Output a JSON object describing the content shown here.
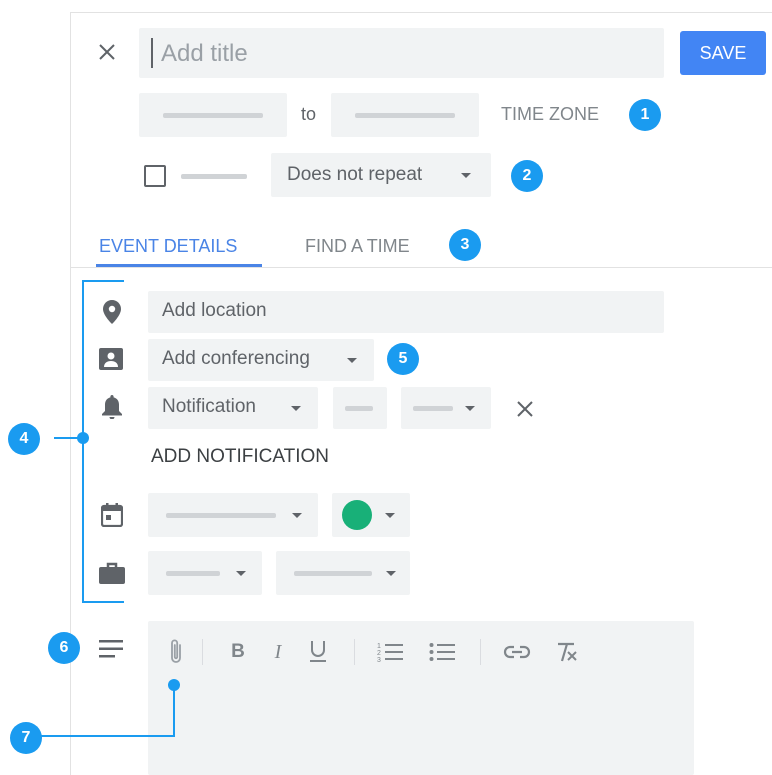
{
  "header": {
    "close_icon": "close-icon",
    "title_placeholder": "Add title",
    "save_label": "SAVE"
  },
  "time_row": {
    "to_label": "to",
    "timezone_label": "TIME ZONE"
  },
  "repeat_row": {
    "repeat_value": "Does not repeat"
  },
  "tabs": [
    {
      "label": "EVENT DETAILS",
      "active": true
    },
    {
      "label": "FIND A TIME",
      "active": false
    }
  ],
  "details": {
    "location_placeholder": "Add location",
    "conferencing_label": "Add conferencing",
    "notification_label": "Notification",
    "add_notification_label": "ADD NOTIFICATION"
  },
  "editor": {
    "tools": [
      "attach-icon",
      "bold-icon",
      "italic-icon",
      "underline-icon",
      "numbered-list-icon",
      "bulleted-list-icon",
      "link-icon",
      "clear-format-icon"
    ]
  },
  "callouts": [
    "1",
    "2",
    "3",
    "4",
    "5",
    "6",
    "7"
  ],
  "colors": {
    "accent": "#4285f4",
    "badge": "#1a9bf0",
    "event_color": "#18b078",
    "tab_active": "#4a84e6"
  }
}
